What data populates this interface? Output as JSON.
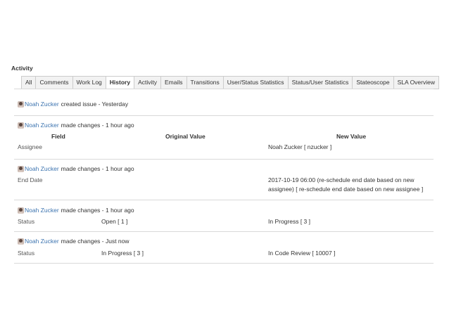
{
  "activity": {
    "title": "Activity"
  },
  "tabs": [
    {
      "label": "All",
      "active": false
    },
    {
      "label": "Comments",
      "active": false
    },
    {
      "label": "Work Log",
      "active": false
    },
    {
      "label": "History",
      "active": true
    },
    {
      "label": "Activity",
      "active": false
    },
    {
      "label": "Emails",
      "active": false
    },
    {
      "label": "Transitions",
      "active": false
    },
    {
      "label": "User/Status Statistics",
      "active": false
    },
    {
      "label": "Status/User Statistics",
      "active": false
    },
    {
      "label": "Stateoscope",
      "active": false
    },
    {
      "label": "SLA Overview",
      "active": false
    }
  ],
  "history": {
    "columns": {
      "field": "Field",
      "original": "Original Value",
      "new": "New Value"
    },
    "entries": [
      {
        "user": "Noah Zucker",
        "action": "created issue - Yesterday"
      },
      {
        "user": "Noah Zucker",
        "action": "made changes - 1 hour ago",
        "field": "Assignee",
        "original": "",
        "new": "Noah Zucker [ nzucker ]"
      },
      {
        "user": "Noah Zucker",
        "action": "made changes - 1 hour ago",
        "field": "End Date",
        "original": "",
        "new_line1": "2017-10-19 06:00 (re-schedule end date based on new",
        "new_line2": "assignee) [ re-schedule end date based on new assignee ]"
      },
      {
        "user": "Noah Zucker",
        "action": "made changes - 1 hour ago",
        "field": "Status",
        "original": "Open [ 1 ]",
        "new": "In Progress [ 3 ]"
      },
      {
        "user": "Noah Zucker",
        "action": "made changes - Just now",
        "field": "Status",
        "original": "In Progress [ 3 ]",
        "new": "In Code Review [ 10007 ]"
      }
    ]
  },
  "colors": {
    "link": "#3b73af",
    "divider": "#d9d9d9",
    "tab_bg": "#f2f2f2"
  },
  "icons": {
    "avatar": "user-avatar-icon"
  }
}
